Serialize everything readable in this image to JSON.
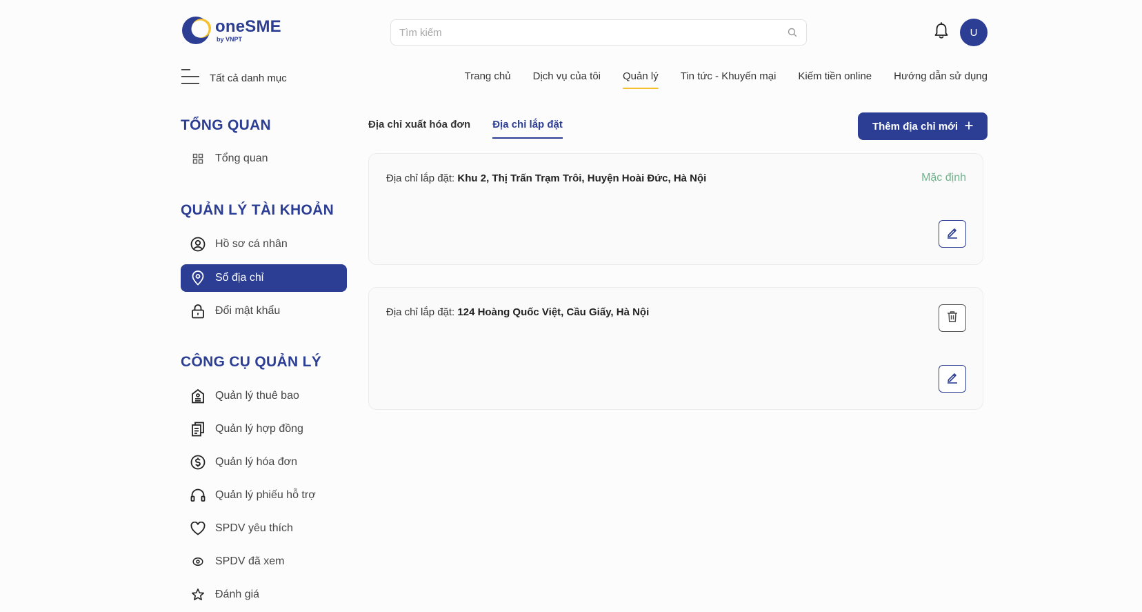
{
  "brand": {
    "name": "oneSME",
    "sub": "by VNPT",
    "primary_color": "#2c3e94",
    "accent_color": "#f5c12e"
  },
  "search": {
    "placeholder": "Tìm kiếm",
    "value": ""
  },
  "header": {
    "avatar_initial": "U",
    "all_categories": "Tất cả danh mục"
  },
  "topnav": [
    {
      "label": "Trang chủ"
    },
    {
      "label": "Dịch vụ của tôi"
    },
    {
      "label": "Quản lý",
      "active": true
    },
    {
      "label": "Tin tức - Khuyến mại"
    },
    {
      "label": "Kiếm tiền online"
    },
    {
      "label": "Hướng dẫn sử dụng"
    }
  ],
  "sidebar": {
    "overview_heading": "TỔNG QUAN",
    "overview_items": [
      {
        "label": "Tổng quan",
        "icon": "grid-icon"
      }
    ],
    "account_heading": "QUẢN LÝ TÀI KHOẢN",
    "account_items": [
      {
        "label": "Hồ sơ cá nhân",
        "icon": "user-circle-icon"
      },
      {
        "label": "Sổ địa chỉ",
        "icon": "map-pin-icon",
        "active": true
      },
      {
        "label": "Đổi mật khẩu",
        "icon": "lock-icon"
      }
    ],
    "tools_heading": "CÔNG CỤ QUẢN LÝ",
    "tools_items": [
      {
        "label": "Quản lý thuê bao",
        "icon": "building-icon"
      },
      {
        "label": "Quản lý hợp đồng",
        "icon": "document-icon"
      },
      {
        "label": "Quản lý hóa đơn",
        "icon": "dollar-circle-icon"
      },
      {
        "label": "Quản lý phiếu hỗ trợ",
        "icon": "headset-icon"
      },
      {
        "label": "SPDV yêu thích",
        "icon": "heart-icon"
      },
      {
        "label": "SPDV đã xem",
        "icon": "eye-icon"
      },
      {
        "label": "Đánh giá",
        "icon": "star-icon"
      }
    ]
  },
  "tabs": [
    {
      "label": "Địa chỉ xuất hóa đơn"
    },
    {
      "label": "Địa chỉ lắp đặt",
      "active": true
    }
  ],
  "add_button": {
    "label": "Thêm địa chỉ mới",
    "icon": "plus-icon"
  },
  "addresses": [
    {
      "prefix": "Địa chỉ lắp đặt:",
      "value": "Khu 2, Thị Trấn Trạm Trôi, Huyện Hoài Đức, Hà Nội",
      "default_label": "Mặc định"
    },
    {
      "prefix": "Địa chỉ lắp đặt:",
      "value": "124 Hoàng Quốc Việt, Cầu Giấy, Hà Nội"
    }
  ]
}
